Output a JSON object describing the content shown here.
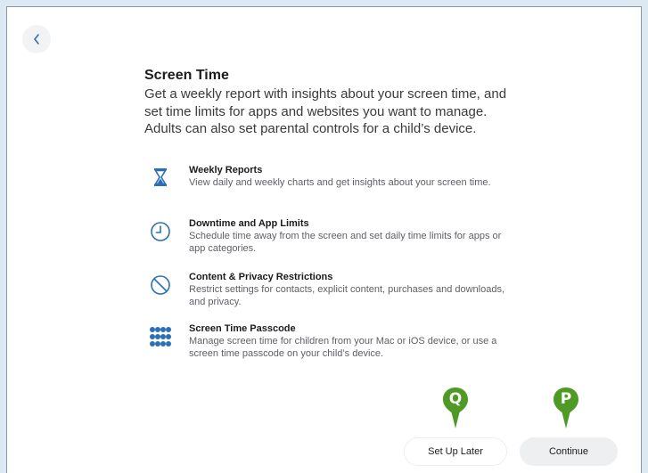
{
  "header": {
    "back_icon": "chevron-left-icon"
  },
  "intro": {
    "title": "Screen Time",
    "description": "Get a weekly report with insights about your screen time, and set time limits for apps and websites you want to manage. Adults can also set parental controls for a child’s device."
  },
  "features": [
    {
      "icon": "hourglass-icon",
      "title": "Weekly Reports",
      "description": "View daily and weekly charts and get insights about your screen time."
    },
    {
      "icon": "clock-icon",
      "title": "Downtime and App Limits",
      "description": "Schedule time away from the screen and set daily time limits for apps or app categories."
    },
    {
      "icon": "prohibited-icon",
      "title": "Content & Privacy Restrictions",
      "description": "Restrict settings for contacts, explicit content, purchases and downloads, and privacy."
    },
    {
      "icon": "keypad-icon",
      "title": "Screen Time Passcode",
      "description": "Manage screen time for children from your Mac or iOS device, or use a screen time passcode on your child’s device."
    }
  ],
  "buttons": {
    "set_up_later": "Set Up Later",
    "continue": "Continue"
  },
  "callouts": {
    "q": "Q",
    "p": "P"
  },
  "colors": {
    "accent": "#2a6fb8",
    "callout": "#4e9a24",
    "page_bg": "#dce9f2"
  }
}
